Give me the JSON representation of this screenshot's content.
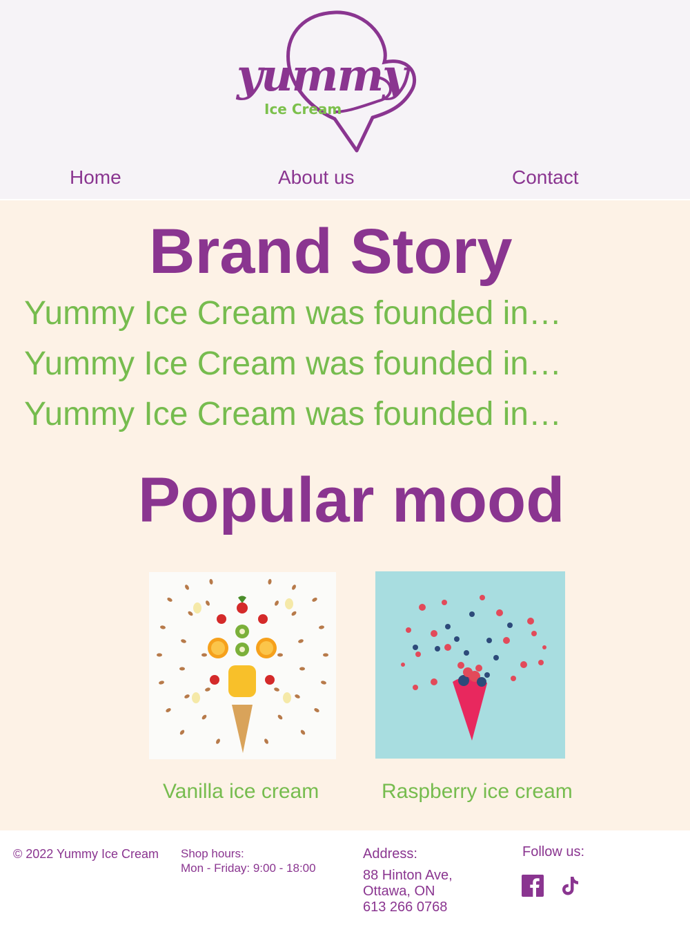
{
  "header": {
    "logo": {
      "main_text": "yummy",
      "sub_text": "Ice Cream"
    },
    "nav": [
      {
        "label": "Home"
      },
      {
        "label": "About us"
      },
      {
        "label": "Contact"
      }
    ]
  },
  "brand_story": {
    "title": "Brand Story",
    "lines": [
      "Yummy Ice Cream was founded in…",
      "Yummy Ice Cream was founded in…",
      "Yummy Ice Cream was founded in…"
    ]
  },
  "popular": {
    "title": "Popular mood",
    "items": [
      {
        "caption": "Vanilla ice cream"
      },
      {
        "caption": "Raspberry ice cream"
      }
    ]
  },
  "footer": {
    "copyright": "© 2022 Yummy Ice Cream",
    "hours_label": "Shop hours:",
    "hours_value": "Mon - Friday: 9:00 - 18:00",
    "address_label": "Address:",
    "address_lines": [
      "88 Hinton Ave,",
      "Ottawa, ON",
      "613 266 0768"
    ],
    "follow_label": "Follow us:",
    "social": [
      "facebook-icon",
      "tiktok-icon"
    ]
  },
  "colors": {
    "brand_purple": "#8a3590",
    "brand_green": "#76bc4e",
    "header_bg": "#f6f3f7",
    "main_bg": "#fdf2e6"
  }
}
